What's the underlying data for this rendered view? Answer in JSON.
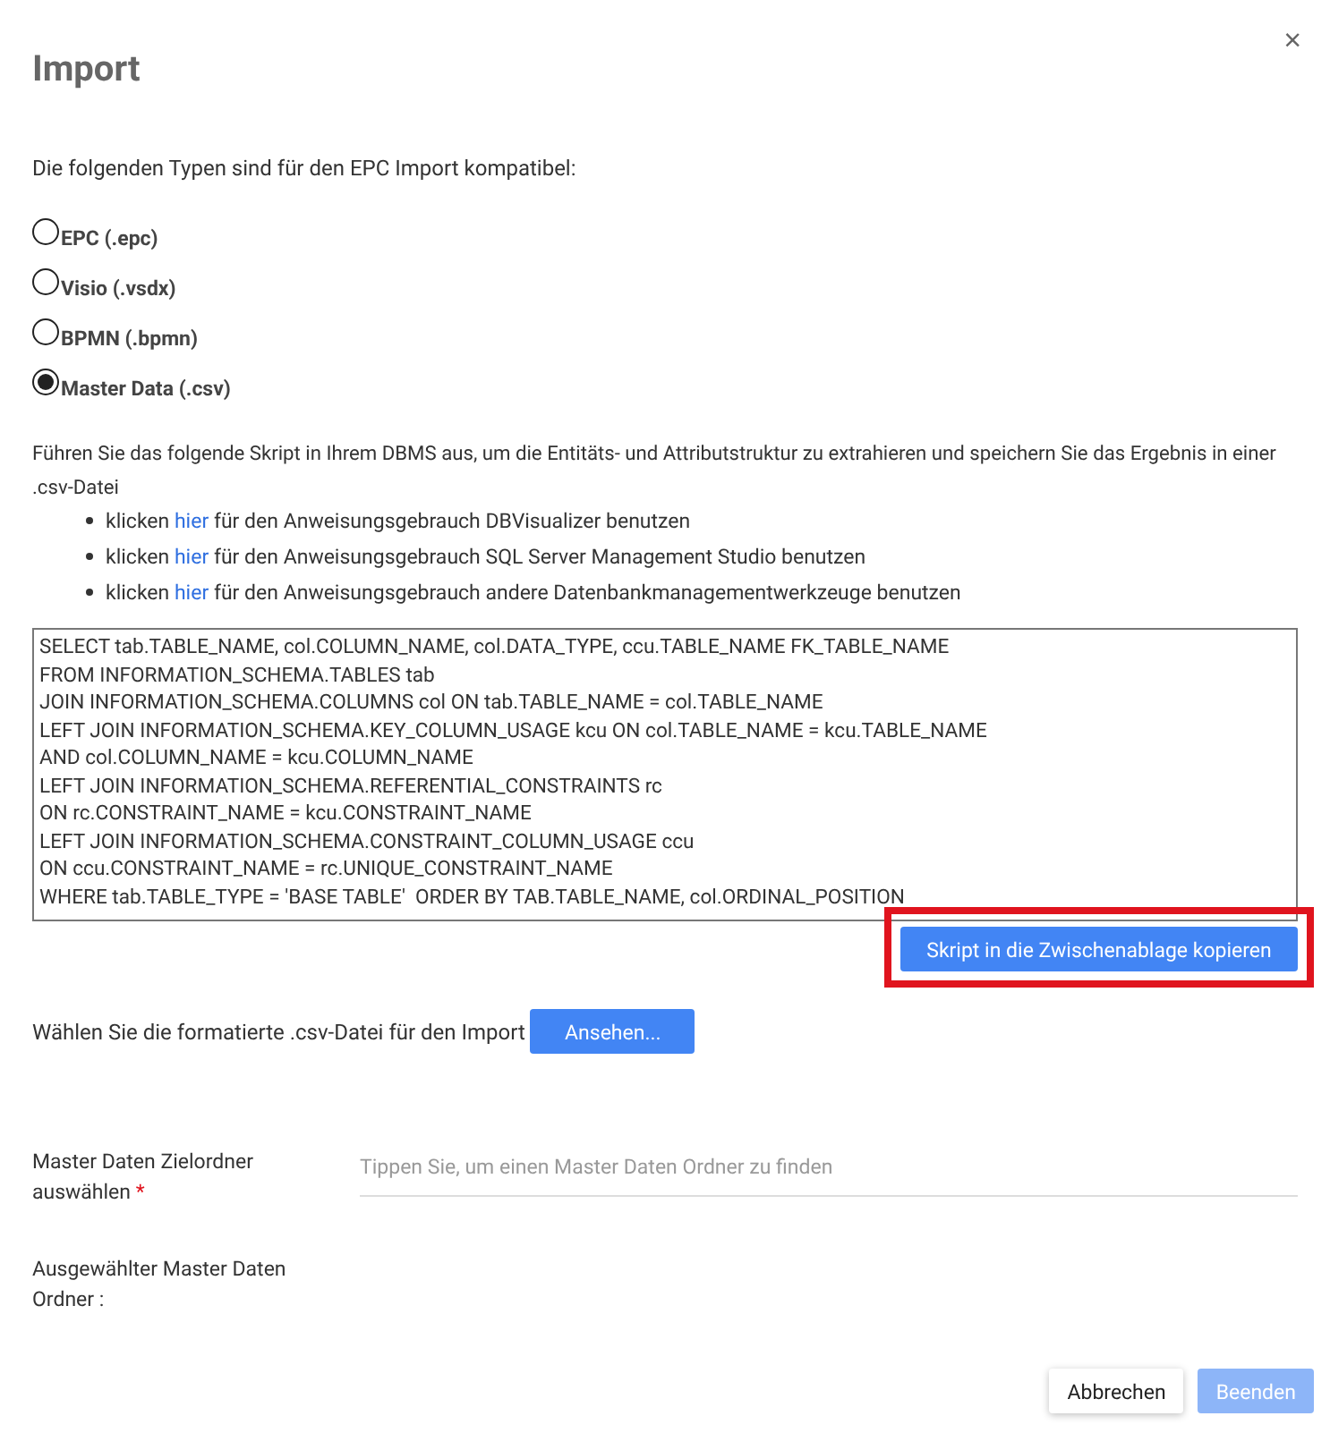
{
  "dialog": {
    "title": "Import",
    "close": "×"
  },
  "intro": "Die folgenden Typen sind für den EPC Import kompatibel:",
  "types": [
    {
      "label": "EPC (.epc)",
      "selected": false
    },
    {
      "label": "Visio (.vsdx)",
      "selected": false
    },
    {
      "label": "BPMN (.bpmn)",
      "selected": false
    },
    {
      "label": "Master Data (.csv)",
      "selected": true
    }
  ],
  "instructions": "Führen Sie das folgende Skript in Ihrem DBMS aus, um die Entitäts- und Attributstruktur zu extrahieren und speichern Sie das Ergebnis in einer .csv-Datei",
  "links": [
    {
      "before": "klicken",
      "link": "hier",
      "after": "für den Anweisungsgebrauch DBVisualizer benutzen"
    },
    {
      "before": "klicken",
      "link": "hier",
      "after": "für den Anweisungsgebrauch SQL Server Management Studio benutzen"
    },
    {
      "before": "klicken",
      "link": "hier",
      "after": "für den Anweisungsgebrauch andere Datenbankmanagementwerkzeuge benutzen"
    }
  ],
  "script_lines": [
    "SELECT tab.TABLE_NAME, col.COLUMN_NAME, col.DATA_TYPE, ccu.TABLE_NAME FK_TABLE_NAME",
    "FROM INFORMATION_SCHEMA.TABLES tab",
    "JOIN INFORMATION_SCHEMA.COLUMNS col ON tab.TABLE_NAME = col.TABLE_NAME",
    "LEFT JOIN INFORMATION_SCHEMA.KEY_COLUMN_USAGE kcu ON col.TABLE_NAME = kcu.TABLE_NAME",
    "AND col.COLUMN_NAME = kcu.COLUMN_NAME",
    "LEFT JOIN INFORMATION_SCHEMA.REFERENTIAL_CONSTRAINTS rc",
    "ON rc.CONSTRAINT_NAME = kcu.CONSTRAINT_NAME",
    "LEFT JOIN INFORMATION_SCHEMA.CONSTRAINT_COLUMN_USAGE ccu",
    "ON ccu.CONSTRAINT_NAME = rc.UNIQUE_CONSTRAINT_NAME",
    "WHERE tab.TABLE_TYPE = 'BASE TABLE'  ORDER BY TAB.TABLE_NAME, col.ORDINAL_POSITION"
  ],
  "copy_button": {
    "label": "Skript in die Zwischenablage kopieren",
    "highlighted": true
  },
  "file_pick": {
    "label": "Wählen Sie die formatierte .csv-Datei für den Import",
    "button": "Ansehen..."
  },
  "target_folder": {
    "label": "Master Daten Zielordner auswählen",
    "required": true,
    "required_mark": "*",
    "placeholder": "Tippen Sie, um einen Master Daten Ordner zu finden"
  },
  "selected_folder": {
    "label": "Ausgewählter Master Daten Ordner :"
  },
  "footer": [
    {
      "label": "Abbrechen",
      "kind": "secondary",
      "disabled": false
    },
    {
      "label": "Beenden",
      "kind": "primary",
      "disabled": true
    }
  ]
}
